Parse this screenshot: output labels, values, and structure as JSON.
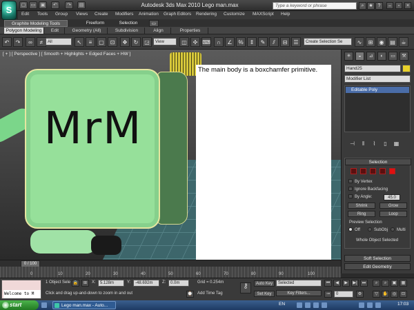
{
  "window": {
    "title": "Autodesk 3ds Max  2010     Lego man.max",
    "search_placeholder": "Type a keyword or phrase"
  },
  "menu": [
    "Edit",
    "Tools",
    "Group",
    "Views",
    "Create",
    "Modifiers",
    "Animation",
    "Graph Editors",
    "Rendering",
    "Customize",
    "MAXScript",
    "Help"
  ],
  "ribbon": {
    "tabs": [
      "Graphite Modeling Tools",
      "Freeform",
      "Selection"
    ],
    "panels": [
      "Polygon Modeling",
      "Edit",
      "Geometry (All)",
      "Subdivision",
      "Align",
      "Properties"
    ]
  },
  "toolbar": {
    "selection_filter": "All",
    "reference_coord": "View",
    "named_selection": "Create Selection Se"
  },
  "viewport": {
    "label": "[ + ] [ Perspective ] [ Smooth + Highlights + Edged Faces + HW ]",
    "model_text": "MrM",
    "note_text": "The main body is a boxchamfer primitive."
  },
  "command_panel": {
    "object_name": "Hand25",
    "object_color": "#e8d12a",
    "modifier_list": "Modifier List",
    "stack_item": "Editable Poly",
    "selection_header": "Selection",
    "by_vertex": "By Vertex",
    "ignore_backfacing": "Ignore Backfacing",
    "by_angle": "By Angle:",
    "by_angle_value": "45.0",
    "shrink": "Shrink",
    "grow": "Grow",
    "ring": "Ring",
    "loop": "Loop",
    "preview_selection": "Preview Selection",
    "preview_off": "Off",
    "preview_subobj": "SubObj",
    "preview_multi": "Multi",
    "whole_object_selected": "Whole Object Selected",
    "soft_selection": "Soft Selection",
    "edit_geometry": "Edit Geometry"
  },
  "timeline": {
    "current_frame": "0 / 100",
    "ticks": [
      "0",
      "10",
      "20",
      "30",
      "40",
      "50",
      "60",
      "70",
      "80",
      "90",
      "100"
    ]
  },
  "status": {
    "maxscript": "Welcome to M",
    "selection_count": "1 Object Sele",
    "prompt": "Click and drag up-and-down to zoom in and out",
    "x_label": "X:",
    "x_value": "5.128m",
    "y_label": "Y:",
    "y_value": "-48.692m",
    "z_label": "Z:",
    "z_value": "0.0m",
    "grid": "Grid = 0.254m",
    "add_time_tag": "Add Time Tag",
    "auto_key": "Auto Key",
    "set_key": "Set Key",
    "key_mode": "Selected",
    "key_filters": "Key Filters...",
    "frame_value": "0"
  },
  "taskbar": {
    "start": "start",
    "task_item": "Lego man.max - Auto...",
    "language": "EN",
    "clock": "17:03"
  }
}
